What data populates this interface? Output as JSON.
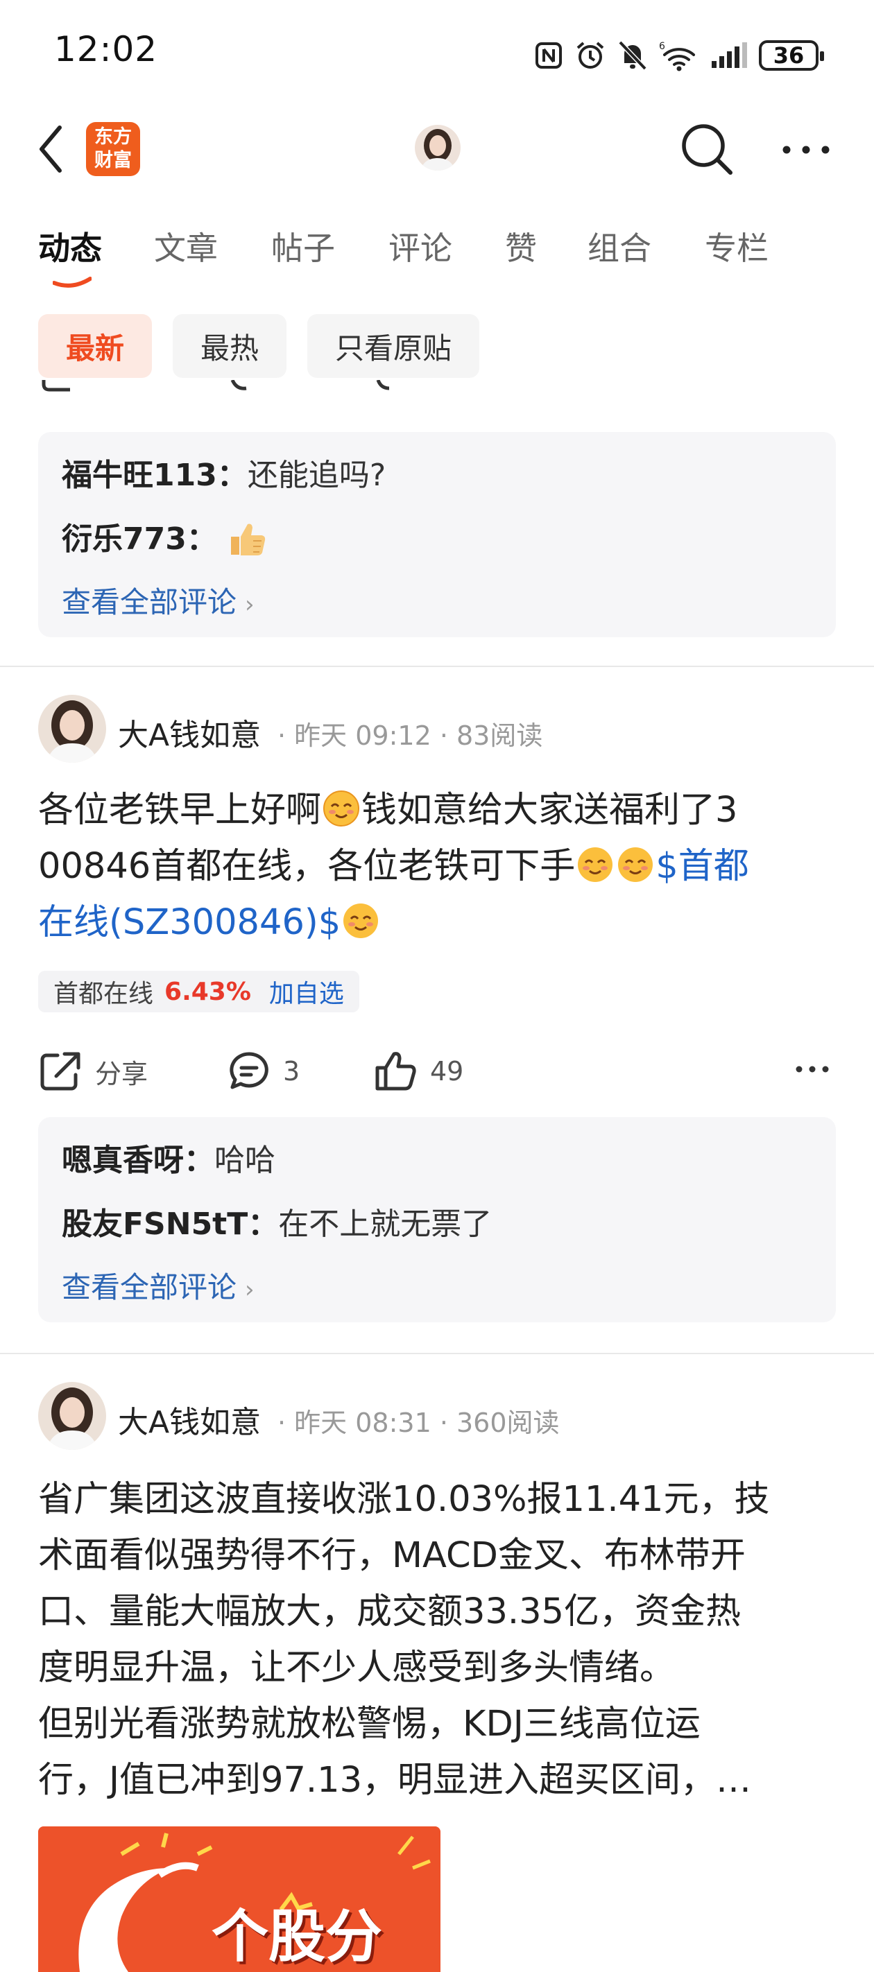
{
  "status_bar": {
    "time": "12:02",
    "battery": "36"
  },
  "header": {
    "logo_line1": "东方",
    "logo_line2": "财富"
  },
  "tabs": [
    "动态",
    "文章",
    "帖子",
    "评论",
    "赞",
    "组合",
    "专栏"
  ],
  "filters": [
    "最新",
    "最热",
    "只看原贴"
  ],
  "top_comments": {
    "items": [
      {
        "user": "福牛旺113：",
        "text": "还能追吗?"
      },
      {
        "user": "衍乐773：",
        "text": ""
      }
    ],
    "view_all": "查看全部评论"
  },
  "posts": [
    {
      "author": "大A钱如意",
      "meta": "· 昨天 09:12 · 83阅读",
      "text_1": "各位老铁早上好啊",
      "text_2": "钱如意给大家送福利了3",
      "text_3": "00846首都在线，各位老铁可下手",
      "link_a": "$首都",
      "link_b": "在线(SZ300846)$",
      "stock": {
        "name": "首都在线",
        "change": "6.43%",
        "add": "加自选"
      },
      "actions": {
        "share": "分享",
        "comments": "3",
        "likes": "49"
      },
      "comments": [
        {
          "user": "嗯真香呀：",
          "text": "哈哈"
        },
        {
          "user": "股友FSN5tT：",
          "text": "在不上就无票了"
        }
      ],
      "view_all": "查看全部评论"
    },
    {
      "author": "大A钱如意",
      "meta": "· 昨天 08:31 · 360阅读",
      "lines": [
        "省广集团这波直接收涨10.03%报11.41元，技",
        "术面看似强势得不行，MACD金叉、布林带开",
        "口、量能大幅放大，成交额33.35亿，资金热",
        "度明显升温，让不少人感受到多头情绪。",
        "但别光看涨势就放松警惕，KDJ三线高位运",
        "行，J值已冲到97.13，明显进入超买区间，…"
      ],
      "image_text": "个股分"
    }
  ],
  "colors": {
    "accent": "#ef4b20",
    "link": "#1f64c8",
    "rise": "#e8392a"
  }
}
